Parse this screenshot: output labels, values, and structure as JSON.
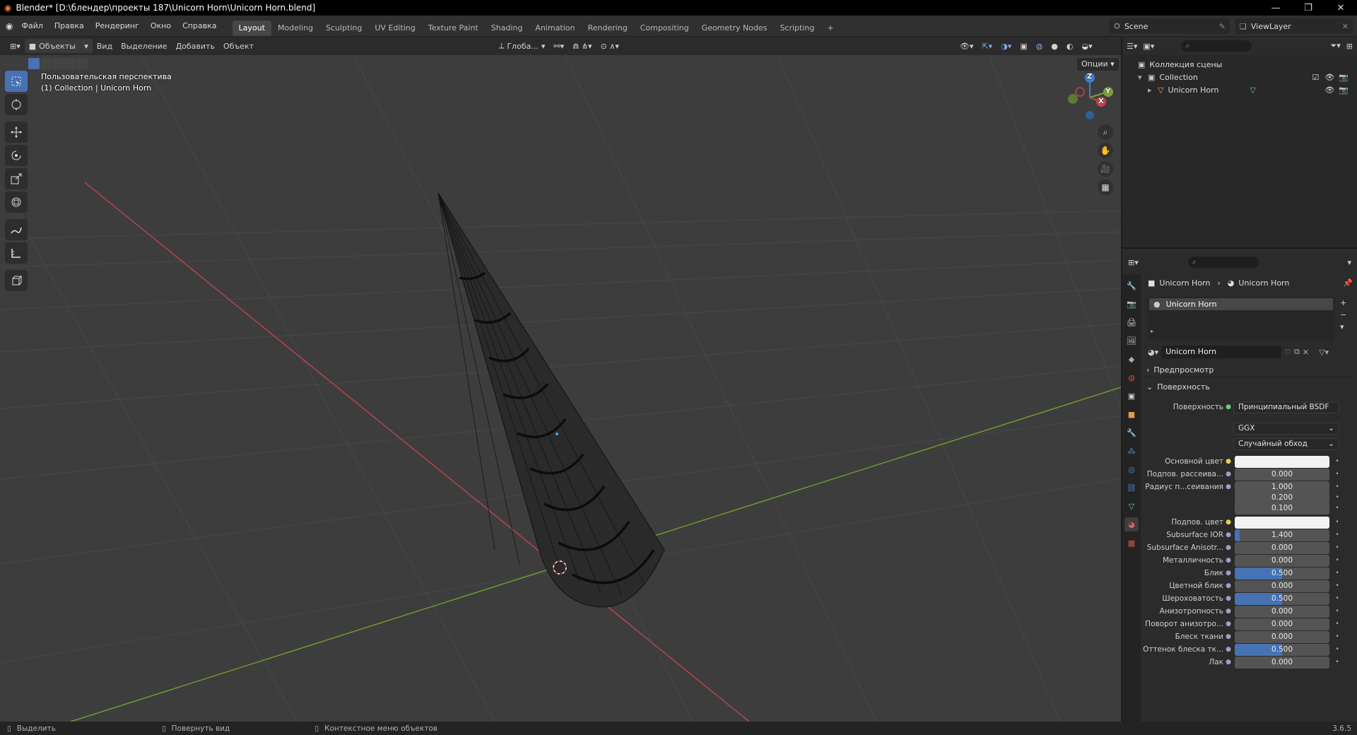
{
  "titlebar": {
    "title": "Blender* [D:\\блендер\\проекты 187\\Unicorn Horn\\Unicorn Horn.blend]",
    "minimize": "—",
    "restore": "❐",
    "close": "✕"
  },
  "menu": [
    "Файл",
    "Правка",
    "Рендеринг",
    "Окно",
    "Справка"
  ],
  "workspaces": [
    "Layout",
    "Modeling",
    "Sculpting",
    "UV Editing",
    "Texture Paint",
    "Shading",
    "Animation",
    "Rendering",
    "Compositing",
    "Geometry Nodes",
    "Scripting"
  ],
  "active_workspace": "Layout",
  "add_workspace": "+",
  "scene": "Scene",
  "view_layer": "ViewLayer",
  "viewport_header": {
    "mode": "Объекты",
    "menus": [
      "Вид",
      "Выделение",
      "Добавить",
      "Объект"
    ],
    "orientation": "Глоба...",
    "options": "Опции"
  },
  "viewport": {
    "view_name": "Пользовательская перспектива",
    "collection_info": "(1) Collection | Unicorn Horn",
    "gizmo_x": "X",
    "gizmo_y": "Y",
    "gizmo_z": "Z"
  },
  "outliner": {
    "scene_collection": "Коллекция сцены",
    "collection": "Collection",
    "object": "Unicorn Horn"
  },
  "properties": {
    "breadcrumb_object": "Unicorn Horn",
    "breadcrumb_material": "Unicorn Horn",
    "slot_name": "Unicorn Horn",
    "material_name": "Unicorn Horn",
    "panel_preview": "Предпросмотр",
    "panel_surface": "Поверхность",
    "surface_label": "Поверхность",
    "surface_value": "Принципиальный BSDF",
    "distribution": "GGX",
    "subsurface_method": "Случайный обход",
    "rows": [
      {
        "label": "Основной цвет",
        "value": "",
        "type": "color",
        "fill": 0
      },
      {
        "label": "Подпов. рассеива...",
        "value": "0.000",
        "type": "num",
        "fill": 0
      },
      {
        "label": "Радиус п...сеивания",
        "value": "1.000",
        "type": "num",
        "fill": 0
      },
      {
        "label": "",
        "value": "0.200",
        "type": "num",
        "fill": 0
      },
      {
        "label": "",
        "value": "0.100",
        "type": "num",
        "fill": 0
      },
      {
        "label": "Подпов. цвет",
        "value": "",
        "type": "color",
        "fill": 0
      },
      {
        "label": "Subsurface IOR",
        "value": "1.400",
        "type": "num",
        "fill": 0.1
      },
      {
        "label": "Subsurface Anisotr...",
        "value": "0.000",
        "type": "num",
        "fill": 0
      },
      {
        "label": "Металличность",
        "value": "0.000",
        "type": "num",
        "fill": 0
      },
      {
        "label": "Блик",
        "value": "0.500",
        "type": "num",
        "fill": 1
      },
      {
        "label": "Цветной блик",
        "value": "0.000",
        "type": "num",
        "fill": 0
      },
      {
        "label": "Шероховатость",
        "value": "0.500",
        "type": "num",
        "fill": 1
      },
      {
        "label": "Анизотропность",
        "value": "0.000",
        "type": "num",
        "fill": 0
      },
      {
        "label": "Поворот анизотро...",
        "value": "0.000",
        "type": "num",
        "fill": 0
      },
      {
        "label": "Блеск ткани",
        "value": "0.000",
        "type": "num",
        "fill": 0
      },
      {
        "label": "Оттенок блеска тк...",
        "value": "0.500",
        "type": "num",
        "fill": 1
      },
      {
        "label": "Лак",
        "value": "0.000",
        "type": "num",
        "fill": 0
      }
    ]
  },
  "statusbar": {
    "select": "Выделить",
    "rotate": "Повернуть вид",
    "context": "Контекстное меню объектов",
    "version": "3.6.5"
  },
  "colors": {
    "accent": "#4772b3",
    "x_axis": "#c8434f",
    "y_axis": "#7ba336",
    "z_axis": "#3f7fcc"
  }
}
